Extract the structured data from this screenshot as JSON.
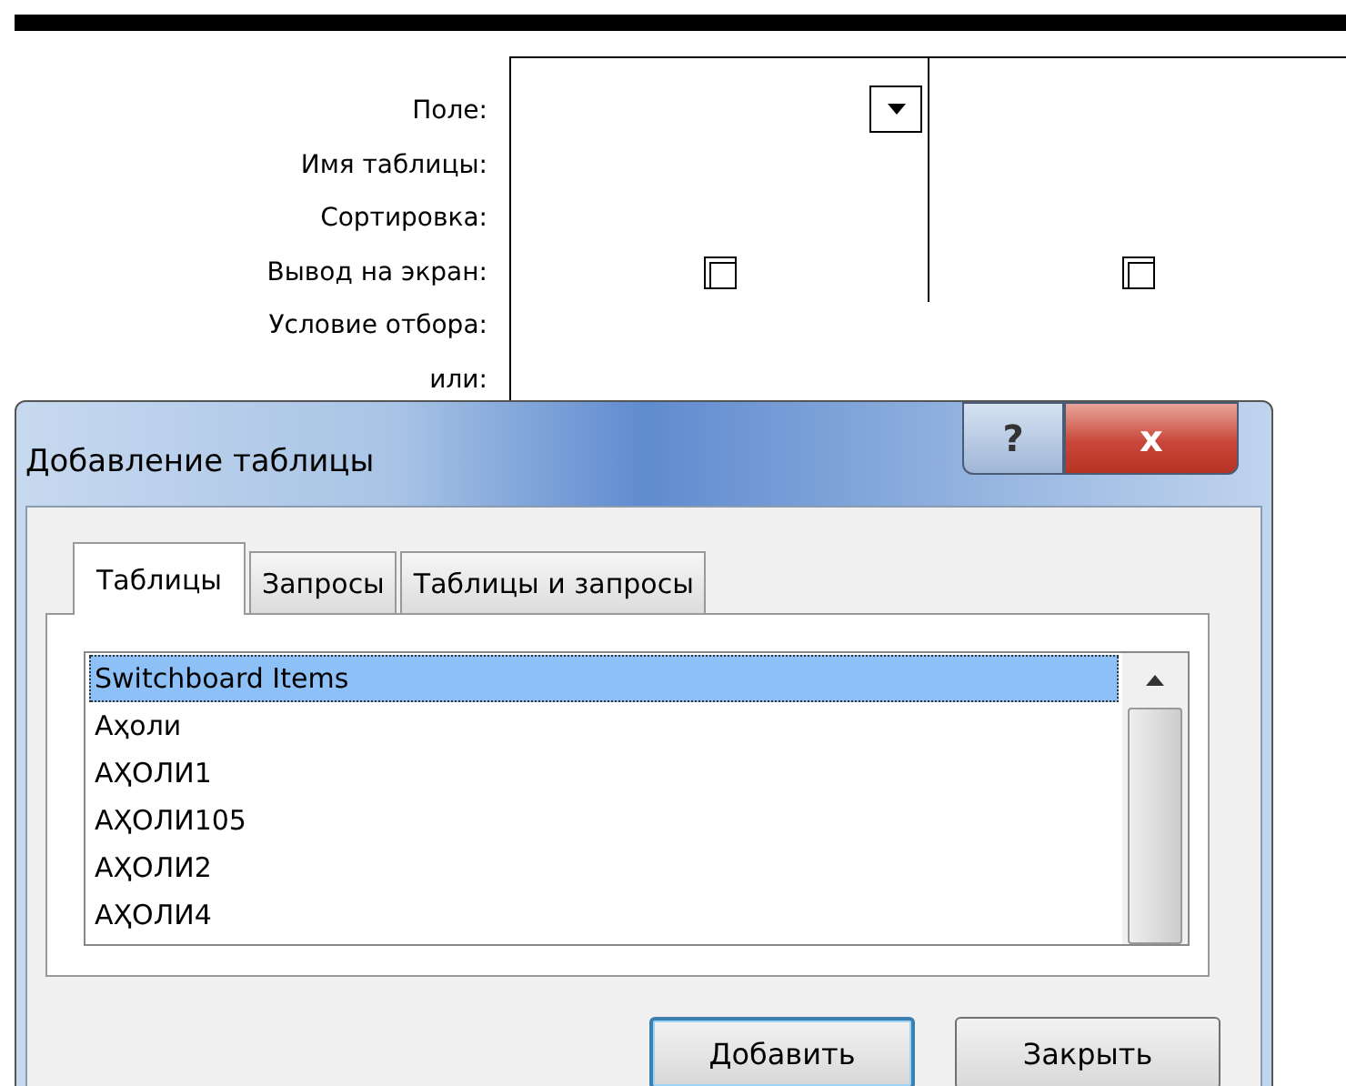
{
  "query_grid": {
    "row_labels": [
      "Поле:",
      "Имя таблицы:",
      "Сортировка:",
      "Вывод на экран:",
      "Условие отбора:",
      "или:"
    ],
    "columns": [
      {
        "has_dropdown": true,
        "show_checked": false
      },
      {
        "has_dropdown": false,
        "show_checked": false
      }
    ]
  },
  "dialog": {
    "title": "Добавление таблицы",
    "help_button": "?",
    "close_button": "x",
    "tabs": [
      {
        "label": "Таблицы",
        "selected": true
      },
      {
        "label": "Запросы",
        "selected": false
      },
      {
        "label": "Таблицы и запросы",
        "selected": false
      }
    ],
    "list_items": [
      {
        "label": "Switchboard Items",
        "selected": true
      },
      {
        "label": "Аҳоли",
        "selected": false
      },
      {
        "label": "АҲОЛИ1",
        "selected": false
      },
      {
        "label": "АҲОЛИ105",
        "selected": false
      },
      {
        "label": "АҲОЛИ2",
        "selected": false
      },
      {
        "label": "АҲОЛИ4",
        "selected": false
      }
    ],
    "buttons": [
      {
        "label": "Добавить",
        "default": true
      },
      {
        "label": "Закрыть",
        "default": false
      }
    ]
  }
}
